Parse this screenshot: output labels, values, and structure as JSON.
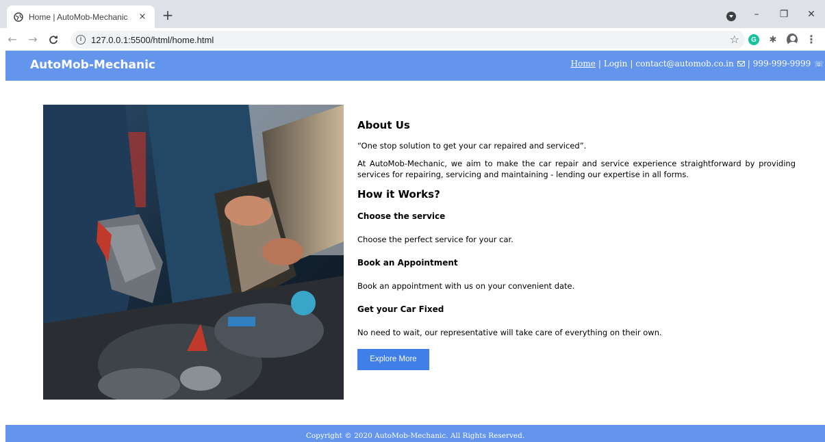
{
  "browser": {
    "tab_title": "Home | AutoMob-Mechanic",
    "close_glyph": "×",
    "new_tab_glyph": "+",
    "url": "127.0.0.1:5500/html/home.html",
    "back_glyph": "←",
    "forward_glyph": "→",
    "reload_glyph": "C",
    "info_glyph": "i",
    "star_glyph": "☆",
    "grammarly_letter": "G",
    "puzzle_glyph": "✱",
    "menu_glyph": "⋮",
    "minimize_glyph": "–",
    "restore_glyph": "❐",
    "window_close_glyph": "✕"
  },
  "header": {
    "brand": "AutoMob-Mechanic",
    "nav": {
      "home": "Home",
      "login": "Login",
      "email": "contact@automob.co.in",
      "phone": "999-999-9999",
      "separator": "|"
    }
  },
  "main": {
    "about_heading": "About Us",
    "tagline": "“One stop solution to get your car repaired and serviced”.",
    "about_text": "At AutoMob-Mechanic, we aim to make the car repair and service experience straightforward by providing services for repairing, servicing and maintaining - lending our expertise in all forms.",
    "how_heading": "How it Works?",
    "steps": [
      {
        "title": "Choose the service",
        "text": "Choose the perfect service for your car."
      },
      {
        "title": "Book an Appointment",
        "text": "Book an appointment with us on your convenient date."
      },
      {
        "title": "Get your Car Fixed",
        "text": "No need to wait, our representative will take care of everything on their own."
      }
    ],
    "cta": "Explore More"
  },
  "footer": {
    "copyright": "Copyright © 2020 AutoMob-Mechanic.  All Rights Reserved."
  },
  "colors": {
    "header_bg": "#6495ed",
    "button_bg": "#3f7fe7",
    "chrome_bg": "#dee1e6"
  }
}
